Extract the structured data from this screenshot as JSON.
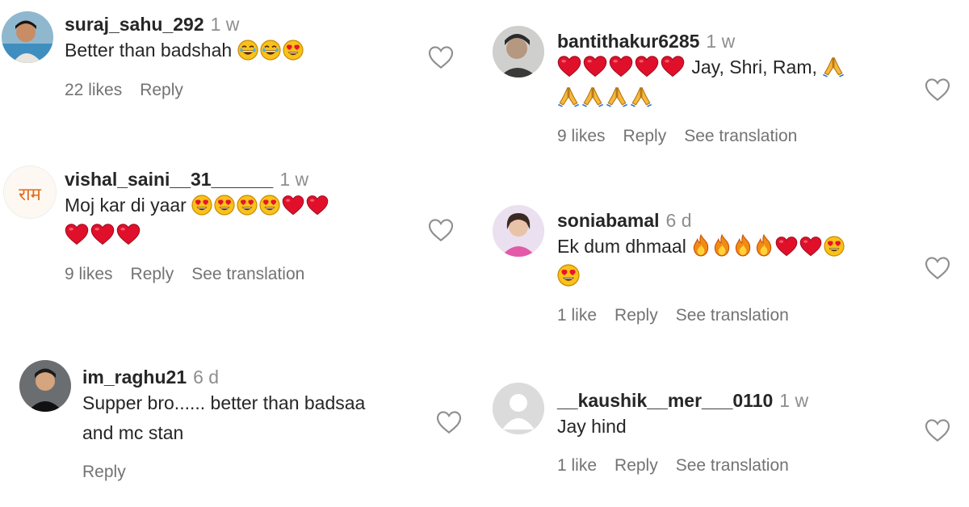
{
  "colors": {
    "username": "#262626",
    "muted": "#8e8e8e",
    "meta": "#737373",
    "heart_red": "#e0102b"
  },
  "comments": [
    {
      "username": "suraj_sahu_292",
      "time": "1 w",
      "text": "Better than badshah",
      "emojis_line1": [
        "laugh-emoji",
        "laugh-emoji",
        "heart-eyes-emoji"
      ],
      "likes": "22 likes",
      "reply": "Reply",
      "translate": ""
    },
    {
      "username": "vishal_saini__31______",
      "time": "1 w",
      "text": "Moj kar di yaar",
      "emojis_line1": [
        "heart-eyes-emoji",
        "heart-eyes-emoji",
        "heart-eyes-emoji",
        "heart-eyes-emoji",
        "red-heart-emoji",
        "red-heart-emoji"
      ],
      "emojis_line2": [
        "red-heart-emoji",
        "red-heart-emoji",
        "red-heart-emoji"
      ],
      "likes": "9 likes",
      "reply": "Reply",
      "translate": "See translation"
    },
    {
      "username": "im_raghu21",
      "time": "6 d",
      "text": "Supper bro...... better than badsaa",
      "text2": "and mc stan",
      "likes": "",
      "reply": "Reply",
      "translate": ""
    },
    {
      "username": "bantithakur6285",
      "time": "1 w",
      "text": "Jay, Shri, Ram,",
      "likes": "9 likes",
      "reply": "Reply",
      "translate": "See translation"
    },
    {
      "username": "soniabamal",
      "time": "6 d",
      "text": "Ek dum dhmaal",
      "likes": "1 like",
      "reply": "Reply",
      "translate": "See translation"
    },
    {
      "username": "__kaushik__mer___0110",
      "time": "1 w",
      "text": "Jay hind",
      "likes": "1 like",
      "reply": "Reply",
      "translate": "See translation"
    }
  ],
  "avatar_logo_text": "राम",
  "icons": {
    "like": "heart-outline-icon"
  }
}
